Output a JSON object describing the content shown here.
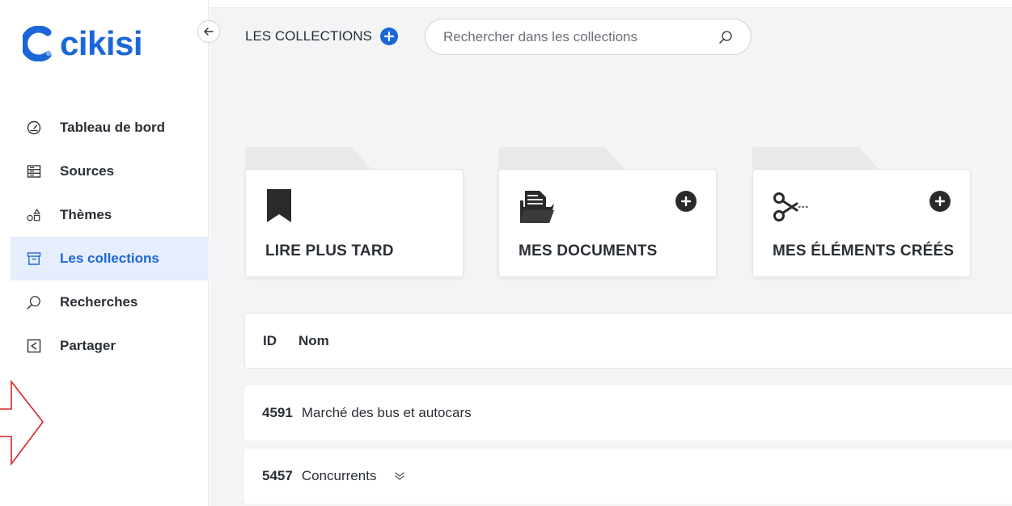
{
  "brand": {
    "name": "cikisi",
    "color": "#1b67d8"
  },
  "sidebar": {
    "collapse_icon": "arrow-left-icon",
    "items": [
      {
        "label": "Tableau de bord",
        "icon": "dashboard-gauge-icon",
        "active": false
      },
      {
        "label": "Sources",
        "icon": "sources-list-icon",
        "active": false
      },
      {
        "label": "Thèmes",
        "icon": "themes-shapes-icon",
        "active": false
      },
      {
        "label": "Les collections",
        "icon": "archive-box-icon",
        "active": true
      },
      {
        "label": "Recherches",
        "icon": "search-icon",
        "active": false
      },
      {
        "label": "Partager",
        "icon": "share-icon",
        "active": false
      }
    ]
  },
  "header": {
    "title": "LES COLLECTIONS",
    "add_icon": "plus-circle-icon",
    "search_placeholder": "Rechercher dans les collections",
    "search_icon": "search-icon"
  },
  "folders": [
    {
      "name": "LIRE PLUS TARD",
      "icon": "bookmark-icon",
      "has_add": false
    },
    {
      "name": "MES DOCUMENTS",
      "icon": "folder-document-icon",
      "has_add": true
    },
    {
      "name": "MES ÉLÉMENTS CRÉÉS",
      "icon": "scissors-icon",
      "has_add": true
    }
  ],
  "table": {
    "columns": [
      "ID",
      "Nom"
    ],
    "rows": [
      {
        "id": "4591",
        "name": "Marché des bus et autocars",
        "expandable": false
      },
      {
        "id": "5457",
        "name": "Concurrents",
        "expandable": true
      }
    ]
  },
  "annotation": {
    "type": "red-outline-arrow",
    "color": "#e02020"
  }
}
